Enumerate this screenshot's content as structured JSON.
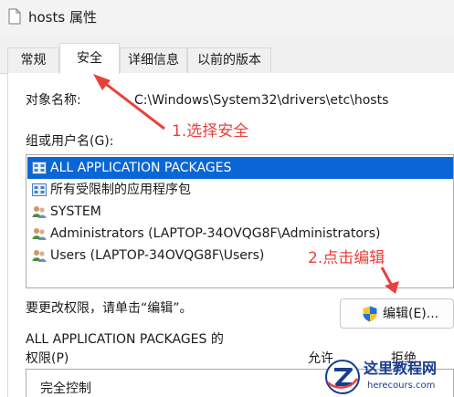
{
  "window": {
    "title": "hosts 属性",
    "icon": "file-icon"
  },
  "tabs": [
    {
      "label": "常规"
    },
    {
      "label": "安全"
    },
    {
      "label": "详细信息"
    },
    {
      "label": "以前的版本"
    }
  ],
  "security": {
    "object_label": "对象名称:",
    "object_path": "C:\\Windows\\System32\\drivers\\etc\\hosts",
    "group_label": "组或用户名(G):",
    "groups": [
      {
        "name": "ALL APPLICATION PACKAGES",
        "icon": "app-packages-icon",
        "selected": true
      },
      {
        "name": "所有受限制的应用程序包",
        "icon": "app-packages-icon",
        "selected": false
      },
      {
        "name": "SYSTEM",
        "icon": "users-icon",
        "selected": false
      },
      {
        "name": "Administrators (LAPTOP-34OVQG8F\\Administrators)",
        "icon": "users-icon",
        "selected": false
      },
      {
        "name": "Users (LAPTOP-34OVQG8F\\Users)",
        "icon": "users-icon",
        "selected": false
      }
    ],
    "change_hint": "要更改权限，请单击“编辑”。",
    "edit_button": {
      "label": "编辑(E)...",
      "icon": "uac-shield-icon"
    },
    "perm_title": "ALL APPLICATION PACKAGES 的",
    "perm_label": "权限(P)",
    "col_allow": "允许",
    "col_deny": "拒绝",
    "permissions": [
      {
        "name": "完全控制"
      }
    ]
  },
  "annotations": {
    "step1": "1.选择安全",
    "step2": "2.点击编辑",
    "color": "#e8403c"
  },
  "watermark": {
    "name": "这里教程网",
    "url": "herecours.com"
  },
  "colors": {
    "selection": "#0a66d4",
    "accent_red": "#e8403c",
    "watermark": "#1a3c8e"
  }
}
